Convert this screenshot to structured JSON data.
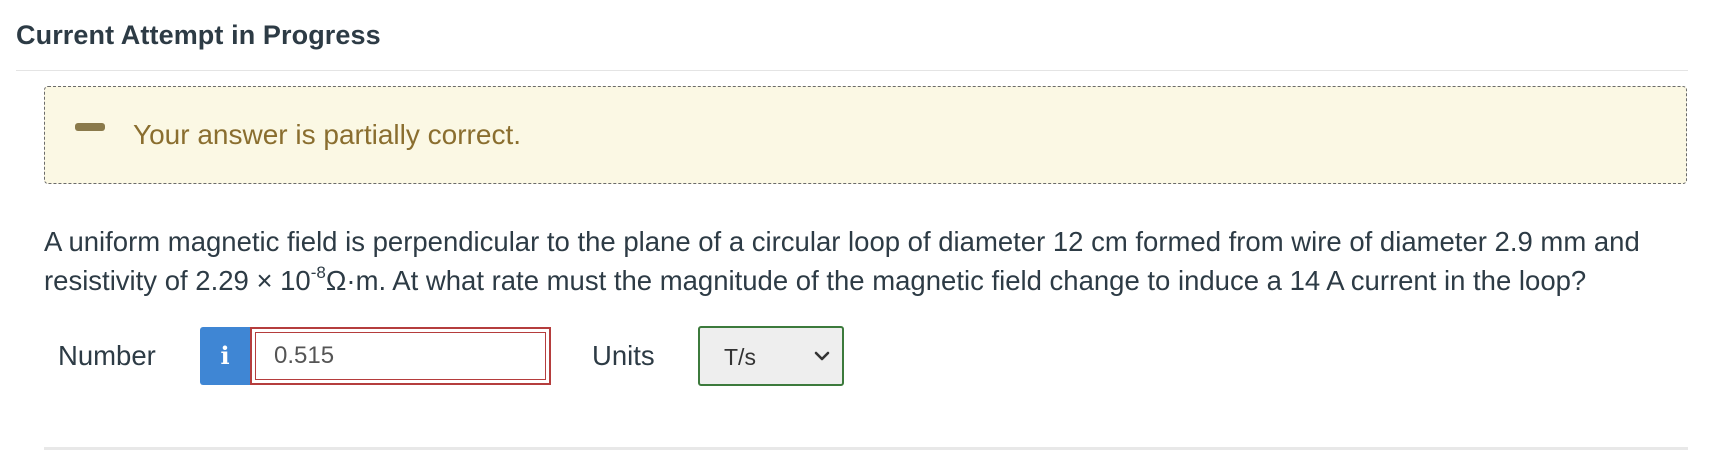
{
  "header": {
    "title": "Current Attempt in Progress"
  },
  "feedback": {
    "icon": "partial-dash-icon",
    "message": "Your answer is partially correct."
  },
  "question": {
    "part1": "A uniform magnetic field is perpendicular to the plane of a circular loop of diameter 12 cm formed from wire of diameter 2.9 mm and resistivity of 2.29 × 10",
    "exponent": "-8",
    "part2": "Ω·m. At what rate must the magnitude of the magnetic field change to induce a 14 A current in the loop?"
  },
  "answer": {
    "number_label": "Number",
    "info_icon": "i",
    "number_value": "0.515",
    "units_label": "Units",
    "units_selected": "T/s"
  },
  "colors": {
    "feedback_bg": "#fbf8e4",
    "feedback_text": "#8a6e2f",
    "input_border_incorrect": "#b53d3d",
    "units_border_correct": "#3c7a3c",
    "info_button": "#3f86d4"
  }
}
